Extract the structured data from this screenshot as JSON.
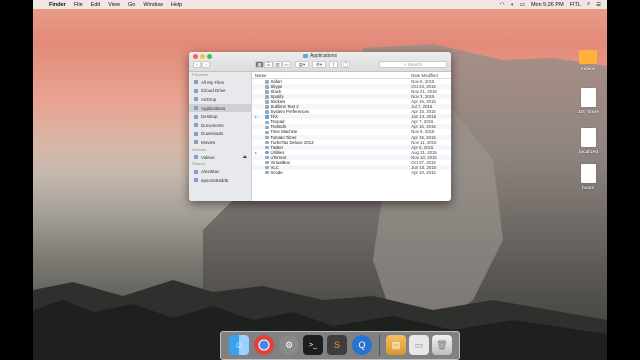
{
  "menubar": {
    "apple": "",
    "app": "Finder",
    "menus": [
      "File",
      "Edit",
      "View",
      "Go",
      "Window",
      "Help"
    ],
    "clock": "Mon 5:26 PM",
    "user": "FITL"
  },
  "desktop_icons": [
    {
      "label": "Videos",
      "kind": "folder"
    },
    {
      "label": ".DS_Store",
      "kind": "file"
    },
    {
      "label": ".localized",
      "kind": "file"
    },
    {
      "label": "hosts",
      "kind": "file"
    }
  ],
  "finder": {
    "title": "Applications",
    "search_placeholder": "Search",
    "sidebar": {
      "favorites_header": "Favorites",
      "favorites": [
        "All My Files",
        "iCloud Drive",
        "AirDrop",
        "Applications",
        "Desktop",
        "Documents",
        "Downloads",
        "Movies"
      ],
      "devices_header": "Devices",
      "devices": [
        "Videos"
      ],
      "shared_header": "Shared",
      "shared": [
        "AlexiMac",
        "epson553dd6"
      ]
    },
    "columns": {
      "name": "Name",
      "date": "Date Modified"
    },
    "rows": [
      {
        "name": "Safari",
        "date": "Nov 6, 2015"
      },
      {
        "name": "Skype",
        "date": "Oct 23, 2015"
      },
      {
        "name": "Slack",
        "date": "Nov 21, 2015"
      },
      {
        "name": "Spotify",
        "date": "Nov 3, 2015"
      },
      {
        "name": "Stickies",
        "date": "Apr 15, 2015"
      },
      {
        "name": "Sublime Text 2",
        "date": "Jul 7, 2015"
      },
      {
        "name": "System Preferences",
        "date": "Apr 15, 2015"
      },
      {
        "name": "TeX",
        "date": "Jan 14, 2015"
      },
      {
        "name": "Texpad",
        "date": "Apr 7, 2015"
      },
      {
        "name": "TextEdit",
        "date": "Apr 15, 2015"
      },
      {
        "name": "Time Machine",
        "date": "Nov 9, 2015"
      },
      {
        "name": "Tomato Timer",
        "date": "Apr 15, 2015"
      },
      {
        "name": "TurboTax Deluxe 2013",
        "date": "Nov 11, 2015"
      },
      {
        "name": "Twitter",
        "date": "Apr 6, 2015"
      },
      {
        "name": "Utilities",
        "date": "Aug 21, 2015"
      },
      {
        "name": "uTorrent",
        "date": "Nov 10, 2015"
      },
      {
        "name": "VirtualBox",
        "date": "Oct 27, 2015"
      },
      {
        "name": "VLC",
        "date": "Jun 10, 2015"
      },
      {
        "name": "Xcode",
        "date": "Apr 10, 2015"
      }
    ]
  },
  "colors": {
    "selection": "#d0d0d4",
    "folder": "#ffb13a",
    "finder_blue": "#5fa6e8"
  }
}
